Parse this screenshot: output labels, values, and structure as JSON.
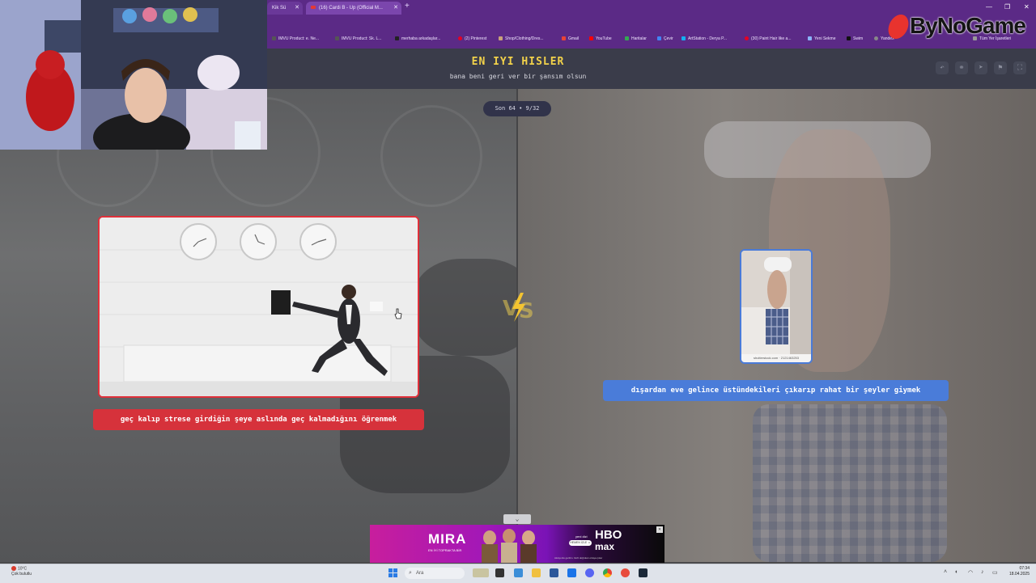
{
  "browser": {
    "tabs": [
      {
        "label": "Kik Sü",
        "active": false
      },
      {
        "label": "(16) Cardi B - Up (Official M...",
        "active": true
      }
    ],
    "bookmarks": [
      "IMVU Product: e. Ne...",
      "IMVU Product: Sk. L...",
      "merhaba arkadaşlar...",
      "(2) Pinterest",
      "Shop/Clothing/Dres...",
      "Gmail",
      "YouTube",
      "Haritalar",
      "Çevir",
      "ArtStation - Derya P...",
      "(30) Paint Hair like a...",
      "Yeni Sekme",
      "Swim",
      "Yandex",
      "Tüm Yer İşaretleri"
    ]
  },
  "overlay": {
    "brand": "ByNoGame"
  },
  "app": {
    "title": "EN IYI HISLER",
    "subtitle": "bana beni geri ver bir şansım olsun",
    "round": "Son 64 • 9/32"
  },
  "left_option": {
    "caption": "geç kalıp strese girdiğin şeye aslında geç kalmadığını öğrenmek",
    "color": "#d6323b"
  },
  "right_option": {
    "caption": "dışardan eve gelince üstündekileri çıkarıp rahat bir şeyler giymek",
    "watermark": "shutterstock.com · 2121463253",
    "color": "#4a7cd9"
  },
  "vs_label": "VS",
  "ad": {
    "title": "MIRA",
    "subtitle": "EN İYİ TOPRAKTA BİR",
    "new_label": "yeni dizi",
    "cta": "HEMEN İZLE ☺",
    "brand_line1": "HBO",
    "brand_line2": "max",
    "footer": "Aksiyonlu gerilim. Gizli doğruları ortaya çıkar"
  },
  "taskbar": {
    "weather_temp": "10°C",
    "weather_desc": "Çok bulutlu",
    "search_placeholder": "Ara",
    "time": "07:34",
    "date": "18.04.2025"
  }
}
